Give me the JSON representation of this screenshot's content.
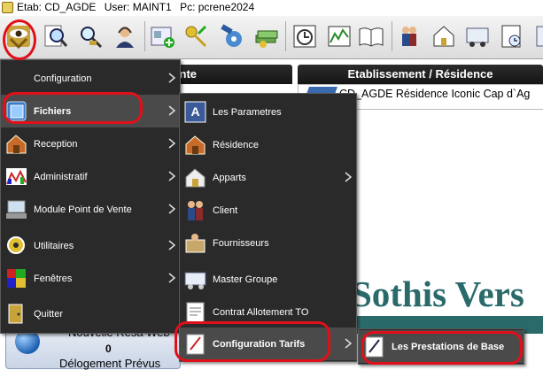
{
  "titlebar": {
    "etab": "Etab: CD_AGDE",
    "user": "User: MAINT1",
    "pc": "Pc: pcrene2024"
  },
  "toolbar": {
    "buttons": [
      "eye-menu-icon",
      "search-document-icon",
      "key-search-icon",
      "user-headset-icon",
      "add-card-icon",
      "keys-icon",
      "satellite-icon",
      "money-stack-icon",
      "clock-calendar-icon",
      "chart-panel-icon",
      "open-book-icon",
      "people-icon",
      "house-hand-icon",
      "vehicle-card-icon",
      "clock-document-icon"
    ]
  },
  "background": {
    "panel_left_header": "nte",
    "panel_right_header": "Etablissement / Résidence",
    "etab_line": "CD_AGDE Résidence Iconic Cap d`Ag",
    "sothis_text": "Sothis Vers",
    "card": {
      "line1": "Nouvelle Resa Web",
      "count": "0",
      "line3": "Délogement Prévus"
    }
  },
  "main_menu": {
    "items": [
      {
        "label": "Configuration",
        "icon": "configuration-icon"
      },
      {
        "label": "Fichiers",
        "icon": "files-icon"
      },
      {
        "label": "Reception",
        "icon": "reception-icon"
      },
      {
        "label": "Administratif",
        "icon": "administratif-icon"
      },
      {
        "label": "Module Point de Vente",
        "icon": "point-of-sale-icon"
      },
      {
        "label": "Utilitaires",
        "icon": "utilitaires-icon"
      },
      {
        "label": "Fenêtres",
        "icon": "windows-icon"
      },
      {
        "label": "Quitter",
        "icon": "quit-icon"
      }
    ]
  },
  "fichiers_menu": {
    "items": [
      {
        "label": "Les Parametres"
      },
      {
        "label": "Résidence"
      },
      {
        "label": "Apparts"
      },
      {
        "label": "Client"
      },
      {
        "label": "Fournisseurs"
      },
      {
        "label": "Master Groupe"
      },
      {
        "label": "Contrat Allotement TO"
      },
      {
        "label": "Configuration Tarifs"
      }
    ]
  },
  "tarifs_menu": {
    "items": [
      {
        "label": "Les Prestations de Base"
      }
    ]
  }
}
